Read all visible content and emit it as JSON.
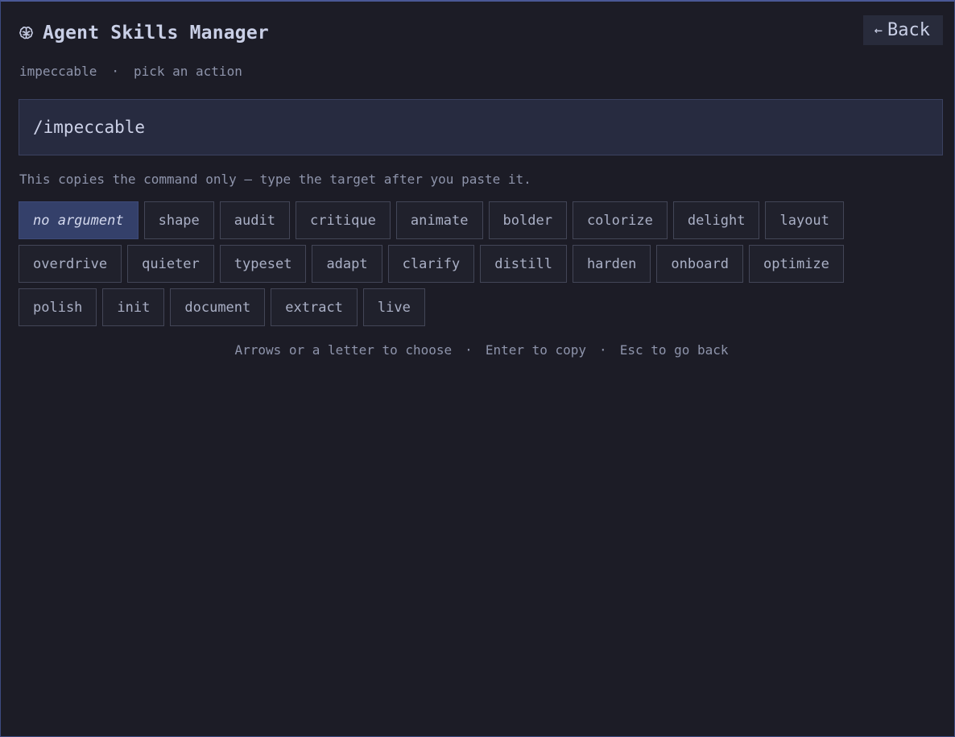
{
  "header": {
    "title": "Agent Skills Manager",
    "icon": "brain-icon",
    "back_label": "Back"
  },
  "subtitle": {
    "skill": "impeccable",
    "separator": "·",
    "instruction": "pick an action"
  },
  "command": {
    "value": "/impeccable"
  },
  "note": "This copies the command only — type the target after you paste it.",
  "actions": [
    {
      "label": "no argument",
      "selected": true
    },
    {
      "label": "shape"
    },
    {
      "label": "audit"
    },
    {
      "label": "critique"
    },
    {
      "label": "animate"
    },
    {
      "label": "bolder"
    },
    {
      "label": "colorize"
    },
    {
      "label": "delight"
    },
    {
      "label": "layout"
    },
    {
      "label": "overdrive"
    },
    {
      "label": "quieter"
    },
    {
      "label": "typeset"
    },
    {
      "label": "adapt"
    },
    {
      "label": "clarify"
    },
    {
      "label": "distill"
    },
    {
      "label": "harden"
    },
    {
      "label": "onboard"
    },
    {
      "label": "optimize"
    },
    {
      "label": "polish"
    },
    {
      "label": "init"
    },
    {
      "label": "document"
    },
    {
      "label": "extract"
    },
    {
      "label": "live"
    }
  ],
  "hint": {
    "choose": "Arrows or a letter to choose",
    "copy": "Enter to copy",
    "back": "Esc to go back",
    "separator": "·"
  },
  "colors": {
    "background": "#1c1c26",
    "accent": "#34406a",
    "command_bg": "#272b40"
  }
}
